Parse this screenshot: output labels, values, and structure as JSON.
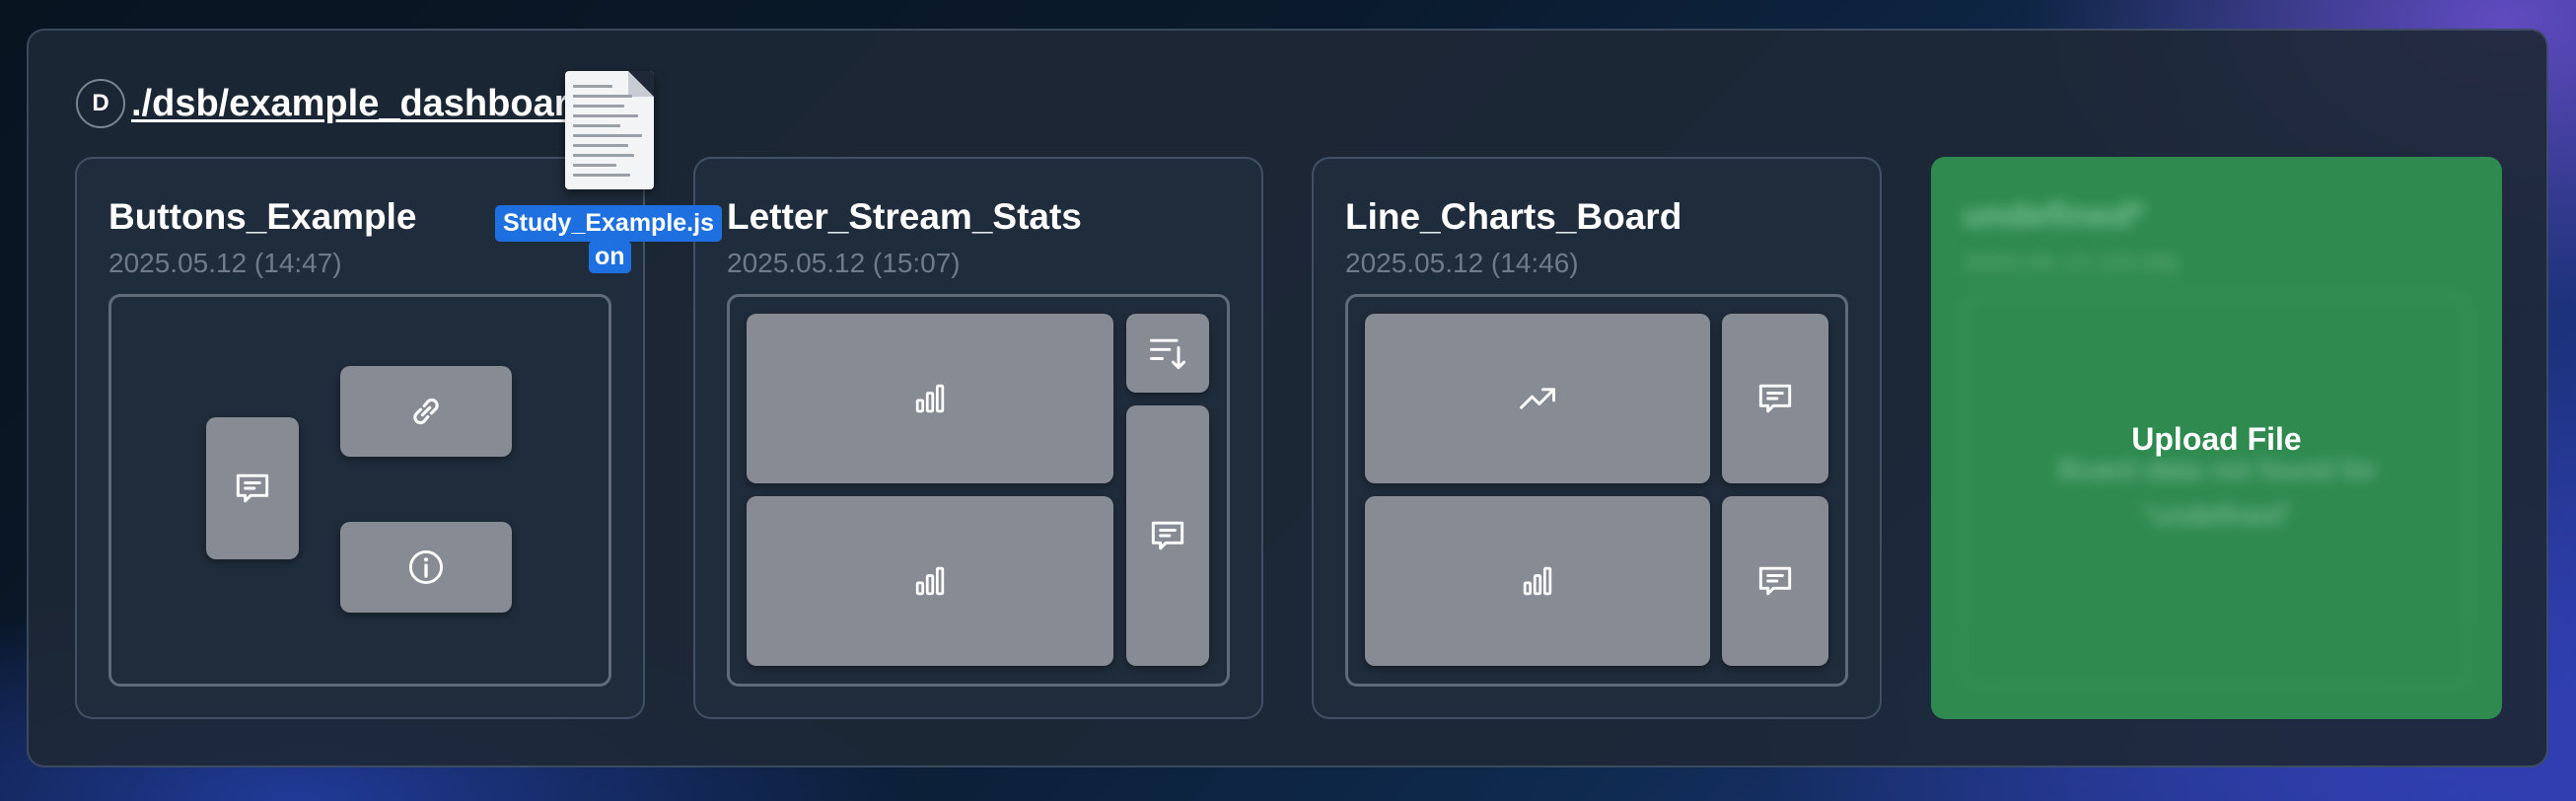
{
  "header": {
    "avatar_letter": "D",
    "path": "./dsb/example_dashboards"
  },
  "cards": [
    {
      "title": "Buttons_Example",
      "date": "2025.05.12 (14:47)"
    },
    {
      "title": "Letter_Stream_Stats",
      "date": "2025.05.12 (15:07)"
    },
    {
      "title": "Line_Charts_Board",
      "date": "2025.05.12 (14:46)"
    }
  ],
  "upload": {
    "title": "undefined*",
    "date": "2025.05.12 (15:08)",
    "message": "Board data not found for \"undefined\"",
    "label": "Upload File"
  },
  "drag": {
    "filename": "Study_Example.js",
    "suffix": "on"
  },
  "icons": {
    "card1": [
      "chat-icon",
      "link-icon",
      "info-icon"
    ],
    "card2": [
      "bar-chart-icon",
      "sort-icon",
      "bar-chart-icon",
      "chat-icon"
    ],
    "card3": [
      "trending-up-icon",
      "chat-icon",
      "bar-chart-icon",
      "chat-icon"
    ]
  },
  "colors": {
    "upload_bg": "#2e8a4f",
    "tile_bg": "#878c94",
    "drag_tag": "#1e6fe0"
  }
}
